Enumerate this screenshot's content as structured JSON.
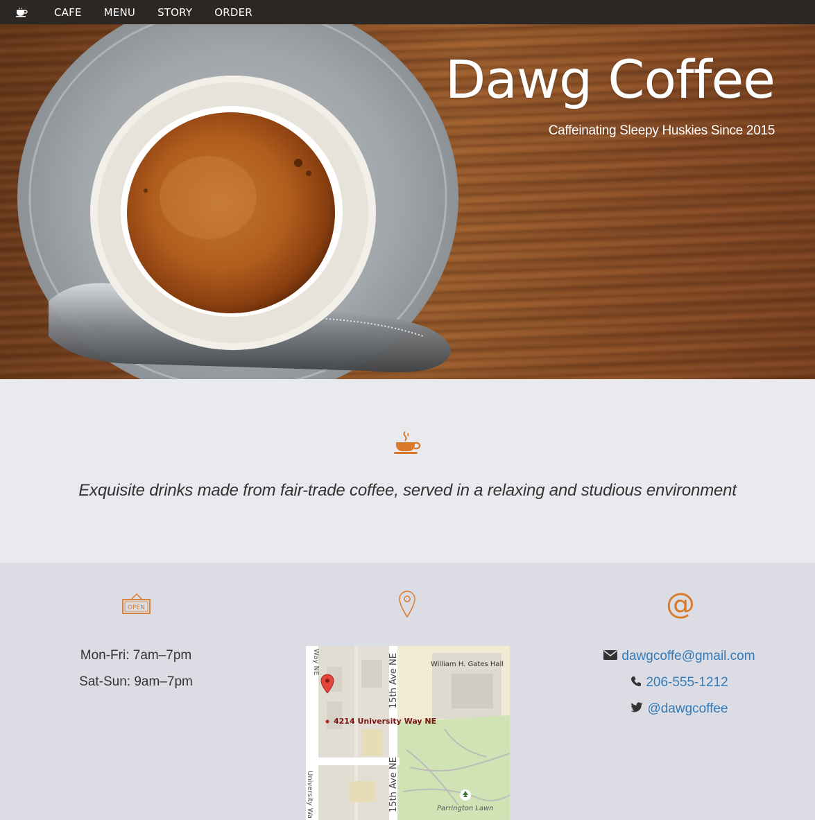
{
  "nav": {
    "brand_icon": "coffee-cup-icon",
    "links": [
      "CAFE",
      "MENU",
      "STORY",
      "ORDER"
    ]
  },
  "hero": {
    "title": "Dawg Coffee",
    "subtitle": "Caffeinating Sleepy Huskies Since 2015"
  },
  "tagline": {
    "icon": "steaming-cup-icon",
    "text": "Exquisite drinks made from fair-trade coffee, served in a relaxing and studious environment"
  },
  "hours": {
    "icon": "open-sign-icon",
    "sign_text": "OPEN",
    "lines": [
      "Mon-Fri: 7am–7pm",
      "Sat-Sun: 9am–7pm"
    ]
  },
  "location": {
    "icon": "map-pin-icon",
    "map": {
      "address": "4214 University Way NE",
      "labels": {
        "univ_way_top": "Way NE",
        "univ_way_bottom": "University Wa",
        "fifteenth_top": "15th Ave NE",
        "fifteenth_bottom": "15th Ave NE",
        "gates_hall": "William H. Gates Hall",
        "parrington": "Parrington Lawn"
      }
    }
  },
  "contact": {
    "icon": "at-sign-icon",
    "email": "dawgcoffe@gmail.com",
    "phone": "206-555-1212",
    "twitter": "@dawgcoffee"
  },
  "colors": {
    "accent": "#d97a2b",
    "link": "#337ab7",
    "nav_bg": "#2b2724"
  }
}
